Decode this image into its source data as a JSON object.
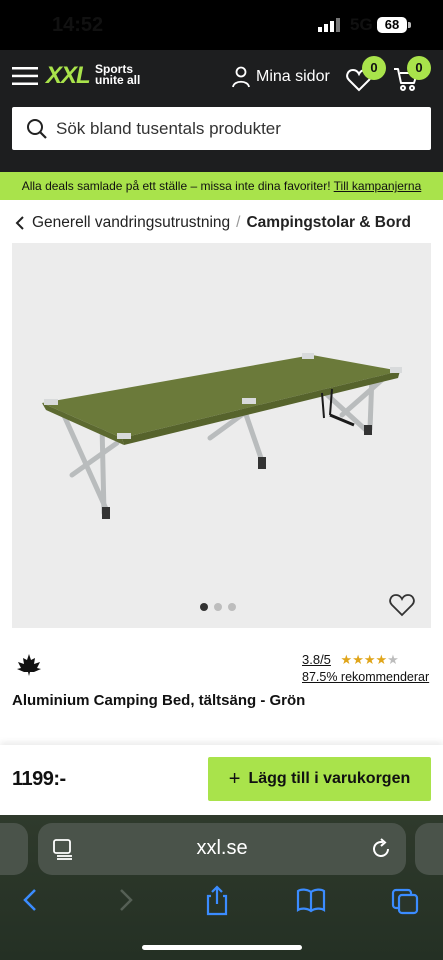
{
  "status": {
    "time": "14:52",
    "network": "5G",
    "battery": "68"
  },
  "header": {
    "logo": "XXL",
    "logo_tag_line1": "Sports",
    "logo_tag_line2": "unite all",
    "account_label": "Mina sidor",
    "wishlist_count": "0",
    "cart_count": "0",
    "search_placeholder": "Sök bland tusentals produkter"
  },
  "promo": {
    "text": "Alla deals samlade på ett ställe – missa inte dina favoriter!",
    "link": "Till kampanjerna"
  },
  "breadcrumb": {
    "parent": "Generell vandringsutrustning",
    "separator": "/",
    "current": "Campingstolar & Bord"
  },
  "gallery": {
    "image_count": 3,
    "active_index": 0
  },
  "product": {
    "brand_logo_text": "MacKenzie",
    "rating": "3.8/5",
    "stars": "★★★★★",
    "rating_value": 3.8,
    "recommend": "87.5% rekommenderar",
    "title": "Aluminium Camping Bed, tältsäng - Grön",
    "price": "1199:-",
    "add_to_cart": "Lägg till i varukorgen"
  },
  "browser": {
    "url": "xxl.se"
  },
  "colors": {
    "accent": "#a9e34b",
    "header_bg": "#1d1e1f",
    "cot_green": "#6b7a3a"
  }
}
